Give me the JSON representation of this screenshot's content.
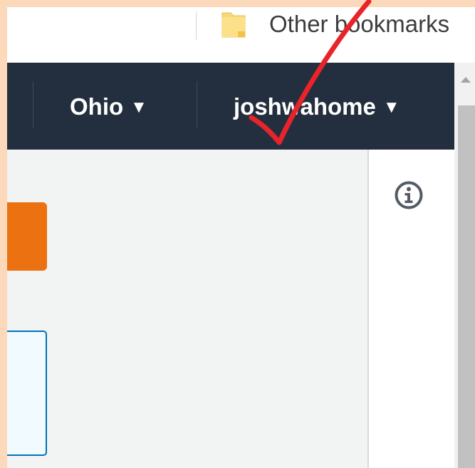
{
  "bookmarks": {
    "other_label": "Other bookmarks",
    "folder_icon": "folder-icon"
  },
  "topnav": {
    "region_label": "Ohio",
    "account_label": "joshwahome",
    "caret": "▼"
  },
  "help": {
    "icon": "info-icon"
  },
  "colors": {
    "nav_bg": "#232f3e",
    "accent_orange": "#ec7211",
    "link_blue": "#0073bb",
    "annotation_red": "#e8242a",
    "outer_frame": "#fcd9bb"
  }
}
